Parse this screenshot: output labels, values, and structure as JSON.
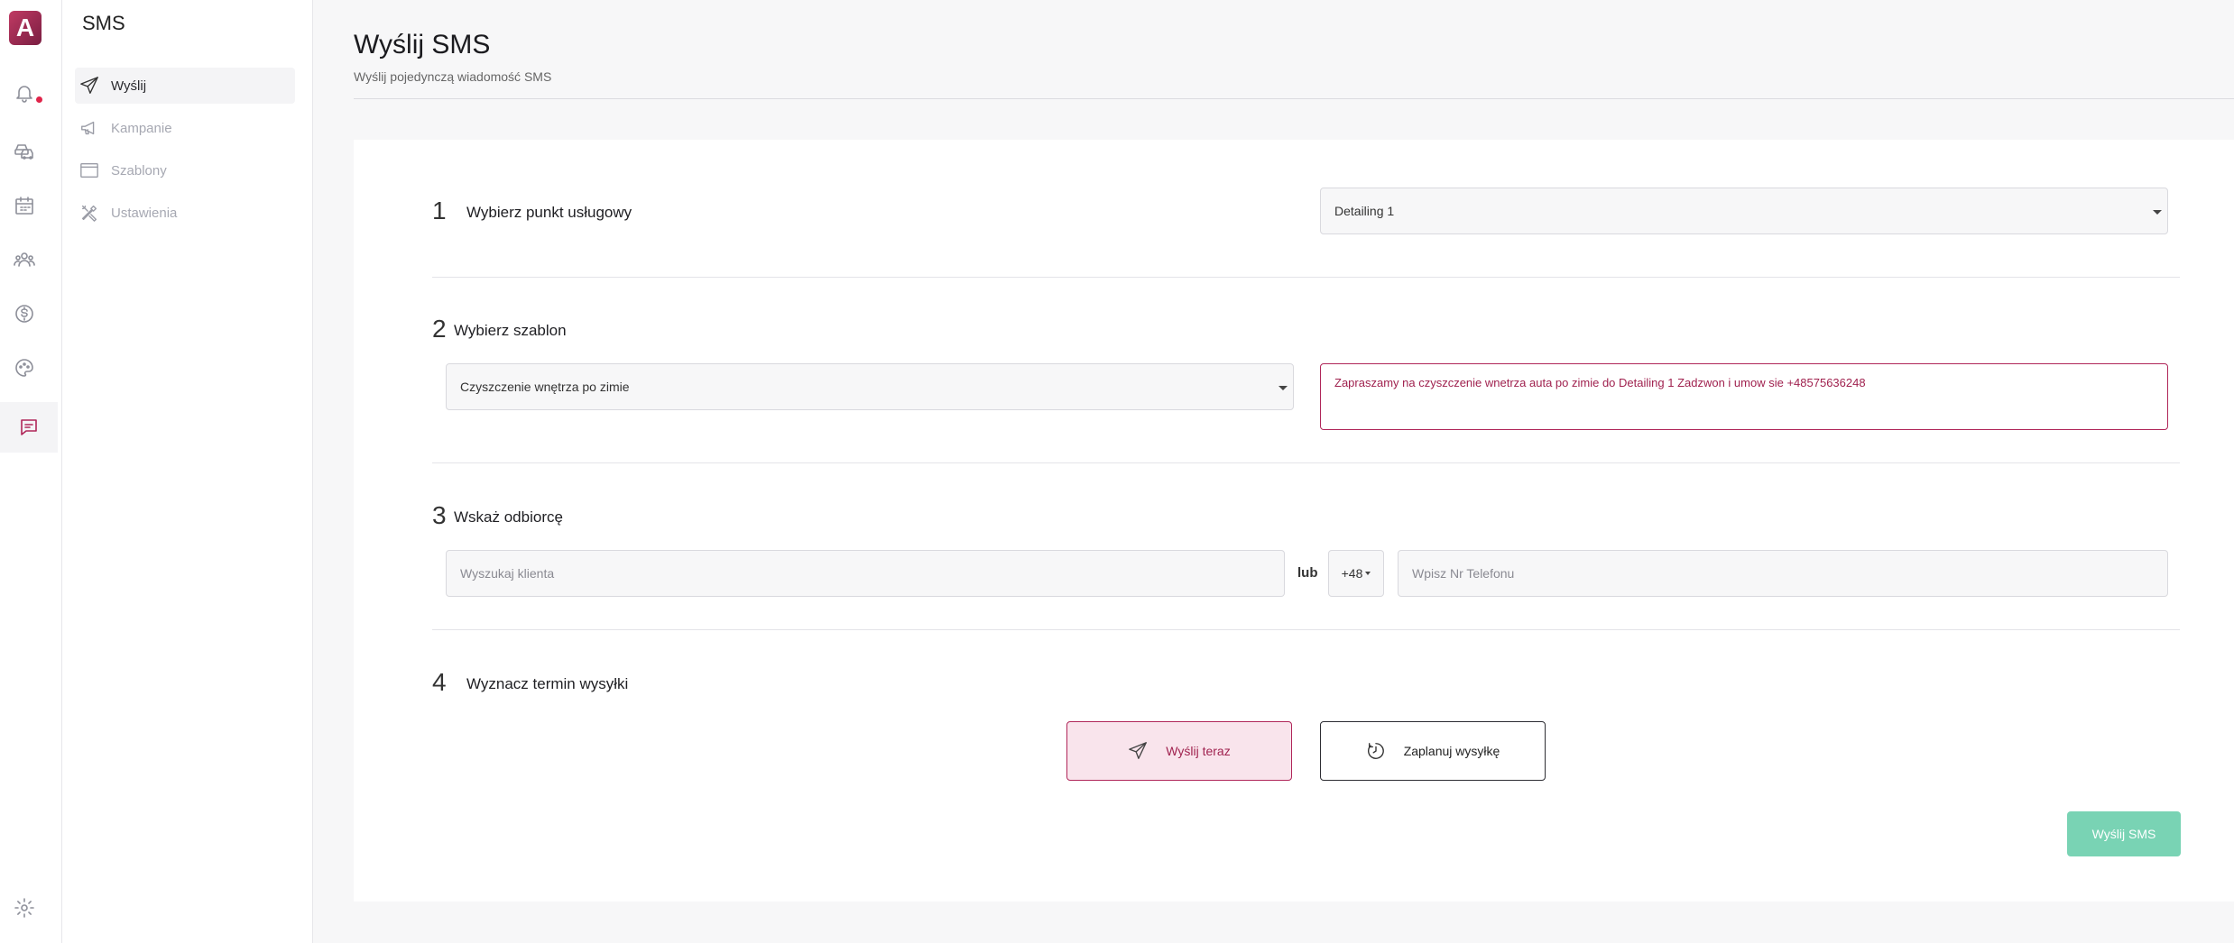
{
  "app": {
    "logo_letter": "A",
    "accent": "#b02659",
    "success": "#79d3b4"
  },
  "rail": {
    "icons": [
      "bell-icon",
      "car-service-icon",
      "calendar-icon",
      "clients-icon",
      "dollar-icon",
      "palette-icon",
      "sms-chat-icon",
      "gear-icon"
    ]
  },
  "subnav": {
    "title": "SMS",
    "items": [
      {
        "label": "Wyślij",
        "icon": "send-icon",
        "active": true
      },
      {
        "label": "Kampanie",
        "icon": "megaphone-icon",
        "active": false
      },
      {
        "label": "Szablony",
        "icon": "template-icon",
        "active": false
      },
      {
        "label": "Ustawienia",
        "icon": "tools-icon",
        "active": false
      }
    ]
  },
  "header": {
    "title": "Wyślij SMS",
    "subtitle": "Wyślij pojedynczą wiadomość SMS"
  },
  "steps": [
    {
      "number": "1",
      "title": "Wybierz punkt usługowy"
    },
    {
      "number": "2",
      "title": "Wybierz szablon"
    },
    {
      "number": "3",
      "title": "Wskaż odbiorcę"
    },
    {
      "number": "4",
      "title": "Wyznacz termin wysyłki"
    }
  ],
  "service_point": {
    "selected": "Detailing 1"
  },
  "template": {
    "selected": "Czyszczenie wnętrza po zimie",
    "preview": "Zapraszamy na czyszczenie wnetrza auta po zimie do Detailing 1 Zadzwon i umow sie +48575636248"
  },
  "recipient": {
    "search_placeholder": "Wyszukaj klienta",
    "or_label": "lub",
    "prefix": "+48",
    "phone_placeholder": "Wpisz Nr Telefonu"
  },
  "schedule": {
    "send_now_label": "Wyślij teraz",
    "schedule_label": "Zaplanuj wysyłkę"
  },
  "submit_label": "Wyślij SMS"
}
